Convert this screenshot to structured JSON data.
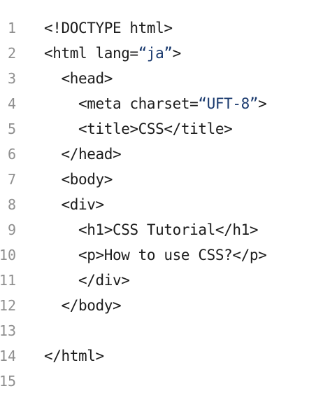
{
  "editor": {
    "lines": [
      {
        "number": "1",
        "indent": "",
        "parts": [
          {
            "text": "<!DOCTYPE html>"
          }
        ]
      },
      {
        "number": "2",
        "indent": "",
        "parts": [
          {
            "text": "<html lang="
          },
          {
            "text": "“ja”",
            "str": true
          },
          {
            "text": ">"
          }
        ]
      },
      {
        "number": "3",
        "indent": "  ",
        "parts": [
          {
            "text": "<head>"
          }
        ]
      },
      {
        "number": "4",
        "indent": "    ",
        "parts": [
          {
            "text": "<meta charset="
          },
          {
            "text": "“UFT-8”",
            "str": true
          },
          {
            "text": ">"
          }
        ]
      },
      {
        "number": "5",
        "indent": "    ",
        "parts": [
          {
            "text": "<title>CSS</title>"
          }
        ]
      },
      {
        "number": "6",
        "indent": "  ",
        "parts": [
          {
            "text": "</head>"
          }
        ]
      },
      {
        "number": "7",
        "indent": "  ",
        "parts": [
          {
            "text": "<body>"
          }
        ]
      },
      {
        "number": "8",
        "indent": "  ",
        "parts": [
          {
            "text": "<div>"
          }
        ]
      },
      {
        "number": "9",
        "indent": "    ",
        "parts": [
          {
            "text": "<h1>CSS Tutorial</h1>"
          }
        ]
      },
      {
        "number": "10",
        "indent": "    ",
        "parts": [
          {
            "text": "<p>How to use CSS?</p>"
          }
        ]
      },
      {
        "number": "11",
        "indent": "    ",
        "parts": [
          {
            "text": "</div>"
          }
        ]
      },
      {
        "number": "12",
        "indent": "  ",
        "parts": [
          {
            "text": "</body>"
          }
        ]
      },
      {
        "number": "13",
        "indent": "",
        "parts": []
      },
      {
        "number": "14",
        "indent": "",
        "parts": [
          {
            "text": "</html>"
          }
        ]
      },
      {
        "number": "15",
        "indent": "",
        "parts": []
      }
    ]
  },
  "colors": {
    "text": "#1c1c1c",
    "string": "#1a3a6e",
    "line_number": "#8f8f8f",
    "background": "#ffffff"
  }
}
